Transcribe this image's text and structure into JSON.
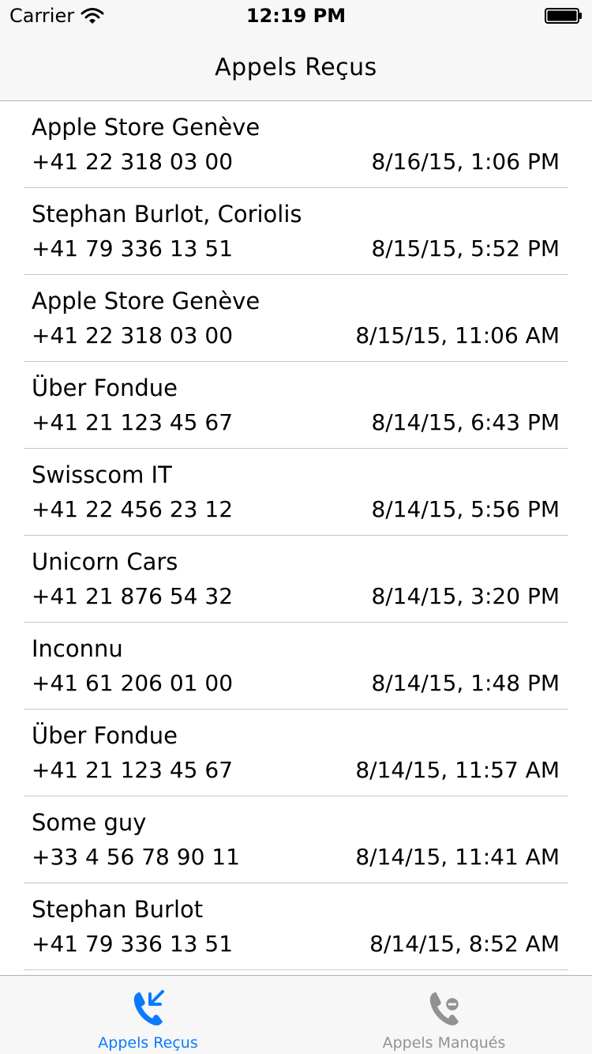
{
  "status_bar": {
    "carrier": "Carrier",
    "time": "12:19 PM"
  },
  "nav": {
    "title": "Appels Reçus"
  },
  "calls": [
    {
      "name": "Apple Store Genève",
      "number": "+41 22 318 03 00",
      "date": "8/16/15, 1:06 PM"
    },
    {
      "name": "Stephan Burlot, Coriolis",
      "number": "+41 79 336 13 51",
      "date": "8/15/15, 5:52 PM"
    },
    {
      "name": "Apple Store Genève",
      "number": "+41 22 318 03 00",
      "date": "8/15/15, 11:06 AM"
    },
    {
      "name": "Über Fondue",
      "number": "+41 21 123 45 67",
      "date": "8/14/15, 6:43 PM"
    },
    {
      "name": "Swisscom IT",
      "number": "+41 22 456 23 12",
      "date": "8/14/15, 5:56 PM"
    },
    {
      "name": "Unicorn Cars",
      "number": "+41 21 876 54 32",
      "date": "8/14/15, 3:20 PM"
    },
    {
      "name": "Inconnu",
      "number": "+41 61 206 01 00",
      "date": "8/14/15, 1:48 PM"
    },
    {
      "name": "Über Fondue",
      "number": "+41 21 123 45 67",
      "date": "8/14/15, 11:57 AM"
    },
    {
      "name": "Some guy",
      "number": "+33 4 56 78 90 11",
      "date": "8/14/15, 11:41 AM"
    },
    {
      "name": "Stephan Burlot",
      "number": "+41 79 336 13 51",
      "date": "8/14/15, 8:52 AM"
    }
  ],
  "tabs": [
    {
      "label": "Appels Reçus",
      "icon": "incoming-call-icon",
      "active": true
    },
    {
      "label": "Appels Manqués",
      "icon": "missed-call-icon",
      "active": false
    }
  ],
  "colors": {
    "accent": "#0a7aff",
    "inactive": "#929292",
    "bar_background": "#f7f7f7",
    "separator": "#c8c7cc"
  }
}
